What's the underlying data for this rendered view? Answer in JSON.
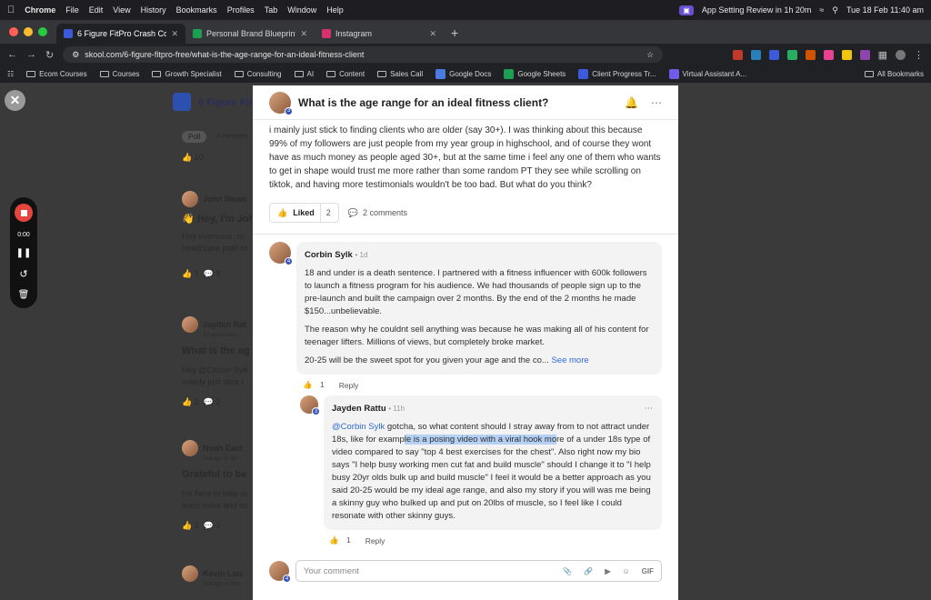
{
  "macbar": {
    "app": "Chrome",
    "menu": [
      "File",
      "Edit",
      "View",
      "History",
      "Bookmarks",
      "Profiles",
      "Tab",
      "Window",
      "Help"
    ],
    "notification": "App Setting Review in 1h 20m",
    "datetime": "Tue 18 Feb  11:40 am"
  },
  "tabs": [
    {
      "title": "6 Figure FitPro Crash Course",
      "color": "#3b5bdb"
    },
    {
      "title": "Personal Brand Blueprint - Te",
      "color": "#1e9e52"
    },
    {
      "title": "Instagram",
      "color": "#d6336c"
    }
  ],
  "address": {
    "url": "skool.com/6-figure-fitpro-free/what-is-the-age-range-for-an-ideal-fitness-client"
  },
  "bookmarks": [
    "Ecom Courses",
    "Courses",
    "Growth Specialist",
    "Consulting",
    "AI",
    "Content",
    "Sales Call",
    "Google Docs",
    "Google Sheets",
    "Client Progress Tr...",
    "Virtual Assistant A..."
  ],
  "bookmarks_right": "All Bookmarks",
  "recorder": {
    "time": "0:00"
  },
  "background": {
    "community": "6 Figure FitPr",
    "poll": "Poll",
    "members": "9 members",
    "posts": [
      {
        "author": "John Nwan",
        "title": "👋 Hey, I'm Joh",
        "snippet1": "Hey everyone, m",
        "snippet2": "healthcare path to",
        "likes": "7",
        "comments": "8"
      },
      {
        "author": "Jayden Rat",
        "meta": "1d ago in Gen",
        "title": "What is the ag",
        "snippet1": "Hey @Corbin Sylk",
        "snippet2": "mainly just stick t",
        "likes": "2",
        "comments": "2"
      },
      {
        "author": "Noah East",
        "meta": "24d ago in Ge",
        "title": "Grateful to be",
        "snippet1": "I'm here to help m",
        "snippet2": "learn more and se",
        "likes": "2",
        "comments": "1"
      },
      {
        "author": "Kevin Luu",
        "meta": "29d ago in Gen",
        "title": "",
        "snippet1": "",
        "snippet2": "",
        "likes": "",
        "comments": ""
      }
    ],
    "top_likes": "10"
  },
  "modal": {
    "title": "What is the age range for an ideal fitness client?",
    "author_level": "3",
    "body": "i mainly just stick to finding clients who are older (say 30+). I was thinking about this because 99% of my followers are just people from my year group in highschool, and of course they wont have as much money as people aged 30+, but at the same time i feel any one of them who wants to get in shape would trust me more rather than some random PT they see while scrolling on tiktok, and having more testimonials wouldn't be too bad. But what do you think?",
    "liked_label": "Liked",
    "like_count": "2",
    "comments_label": "2 comments",
    "comments": [
      {
        "name": "Corbin Sylk",
        "time": "• 1d",
        "level": "4",
        "paragraphs": [
          "18 and under is a death sentence. I partnered with a fitness influencer with 600k followers to launch a fitness program for his audience. We had thousands of people sign up to the pre-launch and built the campaign over 2 months. By the end of the 2 months he made $150...unbelievable.",
          "The reason why he couldnt sell anything was because he was making all of his content for teenager lifters. Millions of views, but completely broke market.",
          "20-25 will be the sweet spot for you given your age and the co..."
        ],
        "see_more": "See more",
        "likes": "1",
        "reply": "Reply"
      },
      {
        "name": "Jayden Rattu",
        "time": "• 11h",
        "level": "3",
        "mention": "@Corbin Sylk",
        "text_a": " gotcha, so what content should I stray away from to not attract under 18s, like for examp",
        "text_highlight": "le is a posing video with a viral hook mo",
        "text_b": "re of a under 18s type of video compared to say \"top 4 best exercises for the chest\". Also right now my bio says \"I help busy working men cut fat and build muscle\" should I change it to \"I help busy 20yr olds bulk up and build muscle\" I feel it would be a better approach as you said 20-25 would be my ideal age range, and also my story if you will was me being a skinny guy who bulked up and put on 20lbs of muscle, so I feel like I could resonate with other skinny guys.",
        "likes": "1",
        "reply": "Reply"
      }
    ],
    "composer_placeholder": "Your comment",
    "composer_level": "4",
    "gif_label": "GIF"
  }
}
